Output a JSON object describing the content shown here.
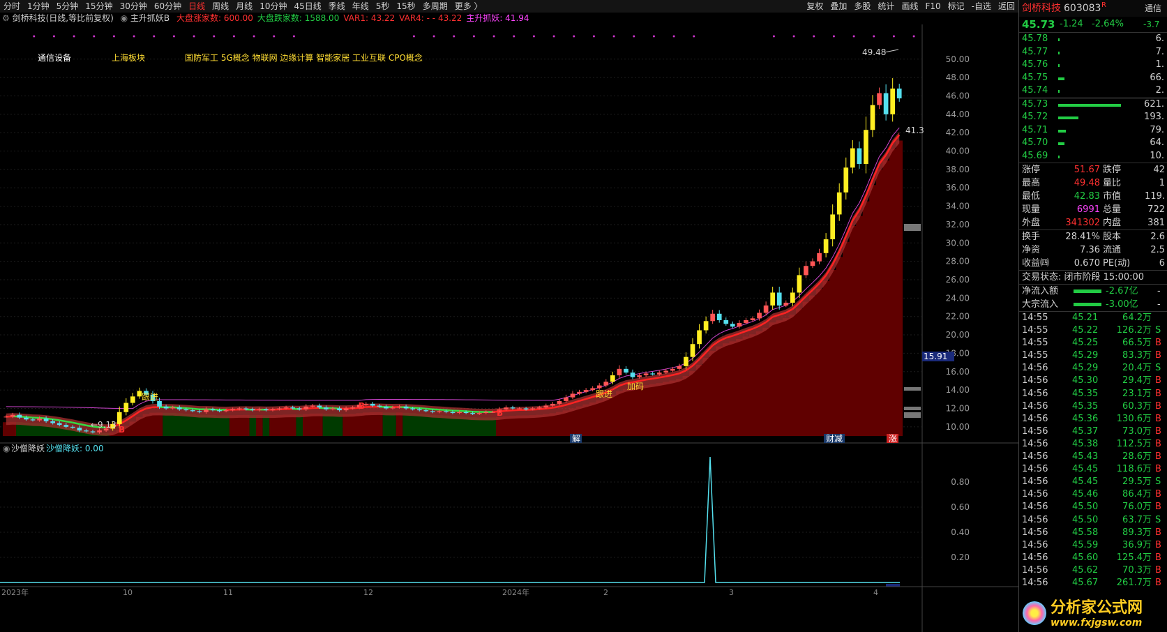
{
  "topbar": {
    "tabs": [
      "分时",
      "1分钟",
      "5分钟",
      "15分钟",
      "30分钟",
      "60分钟",
      "日线",
      "周线",
      "月线",
      "10分钟",
      "45日线",
      "季线",
      "年线",
      "5秒",
      "15秒",
      "多周期",
      "更多 〉"
    ],
    "active": "日线",
    "tools": [
      "复权",
      "叠加",
      "多股",
      "统计",
      "画线",
      "F10",
      "标记",
      "-自选",
      "返回"
    ]
  },
  "title_line": {
    "stock_title": "剑桥科技(日线,等比前复权)",
    "indicator_name": "主升抓妖B",
    "items": [
      {
        "label": "大盘涨家数: ",
        "value": "600.00",
        "color": "#ff3030"
      },
      {
        "label": "大盘跌家数: ",
        "value": "1588.00",
        "color": "#22cc44"
      },
      {
        "label": "VAR1: ",
        "value": "43.22",
        "color": "#ff3030"
      },
      {
        "label": "VAR4: ",
        "value": "- - 43.22",
        "color": "#ff3030"
      },
      {
        "label": "主升抓妖: ",
        "value": "41.94",
        "color": "#ff44ff"
      }
    ]
  },
  "concepts": {
    "industry": "通信设备",
    "region": "上海板块",
    "tags": "国防军工  5G概念  物联网  边缘计算  智能家居  工业互联  CPO概念"
  },
  "chart_data": [
    {
      "type": "candlestick",
      "title": "剑桥科技(日线,等比前复权)",
      "y_ticks": [
        "50.00",
        "48.00",
        "46.00",
        "44.00",
        "42.00",
        "40.00",
        "38.00",
        "36.00",
        "34.00",
        "32.00",
        "30.00",
        "28.00",
        "26.00",
        "24.00",
        "22.00",
        "20.00",
        "18.00",
        "16.00",
        "14.00",
        "12.00",
        "10.00"
      ],
      "ylim": [
        9.0,
        51.5
      ],
      "annotations": {
        "high_label": "49.48",
        "low_label": "9.13",
        "right_value": "41.3",
        "price_box": "15.91",
        "signals": [
          "B",
          "跟进",
          "B",
          "B",
          "跟进",
          "加码",
          "解",
          "财减",
          "涨"
        ]
      },
      "close": [
        11.1,
        11.3,
        11.0,
        10.8,
        10.7,
        10.9,
        10.6,
        10.4,
        10.2,
        10.0,
        9.9,
        9.6,
        9.5,
        9.4,
        9.6,
        9.8,
        10.3,
        11.6,
        12.6,
        13.3,
        13.9,
        13.5,
        12.8,
        12.2,
        12.0,
        12.1,
        11.9,
        11.8,
        11.7,
        11.6,
        11.9,
        11.8,
        11.7,
        11.8,
        11.9,
        12.0,
        11.9,
        11.8,
        11.9,
        11.8,
        11.9,
        12.0,
        12.1,
        12.0,
        11.9,
        12.2,
        12.3,
        12.1,
        11.9,
        12.0,
        11.8,
        12.0,
        12.1,
        12.4,
        12.5,
        12.3,
        12.2,
        12.0,
        12.1,
        12.2,
        12.0,
        11.9,
        11.8,
        11.7,
        11.6,
        11.7,
        11.6,
        11.5,
        11.6,
        11.5,
        11.4,
        11.5,
        11.6,
        11.6,
        11.9,
        12.1,
        12.0,
        12.0,
        11.9,
        12.0,
        12.1,
        12.3,
        12.5,
        12.8,
        13.2,
        13.6,
        13.8,
        14.0,
        14.2,
        14.5,
        14.9,
        15.6,
        16.3,
        15.9,
        15.4,
        15.6,
        15.8,
        15.7,
        15.9,
        16.1,
        16.3,
        16.6,
        17.6,
        19.0,
        20.5,
        21.5,
        22.3,
        21.6,
        21.2,
        20.9,
        21.3,
        21.6,
        21.8,
        22.4,
        23.2,
        24.6,
        23.2,
        23.5,
        24.6,
        26.5,
        27.5,
        28.0,
        28.9,
        30.4,
        33.1,
        35.5,
        38.2,
        40.3,
        38.6,
        42.3,
        45.0,
        46.3,
        44.0,
        46.8,
        45.73
      ]
    },
    {
      "type": "line",
      "title": "沙僧降妖",
      "series_name": "沙僧降妖",
      "value_label": "0.00",
      "y_ticks": [
        "0.80",
        "0.60",
        "0.40",
        "0.20"
      ],
      "ylim": [
        0,
        1
      ],
      "values_note": "zero everywhere except a single spike to 1 near the right side"
    }
  ],
  "x_axis_labels": [
    "2023年",
    "10",
    "11",
    "12",
    "2024年",
    "2",
    "3",
    "4"
  ],
  "right_panel": {
    "name": "剑桥科技",
    "code": "603083",
    "code_flag": "R",
    "price": "45.73",
    "change": "-1.24",
    "pct": "-2.64%",
    "sector_tag": "通信",
    "sector_pct": "-3.7",
    "asks": [
      {
        "p": "45.78",
        "v": "6.",
        "w": 2
      },
      {
        "p": "45.77",
        "v": "7.",
        "w": 2
      },
      {
        "p": "45.76",
        "v": "1.",
        "w": 2
      },
      {
        "p": "45.75",
        "v": "66.",
        "w": 10
      },
      {
        "p": "45.74",
        "v": "2.",
        "w": 2
      }
    ],
    "bids": [
      {
        "p": "45.73",
        "v": "621.",
        "w": 100
      },
      {
        "p": "45.72",
        "v": "193.",
        "w": 32
      },
      {
        "p": "45.71",
        "v": "79.",
        "w": 12
      },
      {
        "p": "45.70",
        "v": "64.",
        "w": 10
      },
      {
        "p": "45.69",
        "v": "10.",
        "w": 2
      }
    ],
    "stats": [
      {
        "k1": "涨停",
        "v1": "51.67",
        "c1": "#ff3030",
        "k2": "跌停",
        "v2": "42"
      },
      {
        "k1": "最高",
        "v1": "49.48",
        "c1": "#ff3030",
        "k2": "量比",
        "v2": "1"
      },
      {
        "k1": "最低",
        "v1": "42.83",
        "c1": "#22cc44",
        "k2": "市值",
        "v2": "119."
      },
      {
        "k1": "现量",
        "v1": "6991",
        "c1": "#ff44ff",
        "k2": "总量",
        "v2": "722"
      },
      {
        "k1": "外盘",
        "v1": "341302",
        "c1": "#ff3030",
        "k2": "内盘",
        "v2": "381"
      }
    ],
    "stats2": [
      {
        "k1": "换手",
        "v1": "28.41%",
        "c1": "#d0d0d0",
        "k2": "股本",
        "v2": "2.6"
      },
      {
        "k1": "净资",
        "v1": "7.36",
        "c1": "#d0d0d0",
        "k2": "流通",
        "v2": "2.5"
      },
      {
        "k1": "收益㈣",
        "v1": "0.670",
        "c1": "#d0d0d0",
        "k2": "PE(动)",
        "v2": "6"
      }
    ],
    "trade_status": "交易状态: 闭市阶段 15:00:00",
    "flows": [
      {
        "k": "净流入额",
        "v": "-2.67亿",
        "rest": "-"
      },
      {
        "k": "大宗流入",
        "v": "-3.00亿",
        "rest": "-"
      }
    ],
    "ticks": [
      {
        "t": "14:55",
        "p": "45.21",
        "v": "64.2万",
        "bs": ""
      },
      {
        "t": "14:55",
        "p": "45.22",
        "v": "126.2万",
        "bs": "S"
      },
      {
        "t": "14:55",
        "p": "45.25",
        "v": "66.5万",
        "bs": "B"
      },
      {
        "t": "14:55",
        "p": "45.29",
        "v": "83.3万",
        "bs": "B"
      },
      {
        "t": "14:56",
        "p": "45.29",
        "v": "20.4万",
        "bs": "S"
      },
      {
        "t": "14:56",
        "p": "45.30",
        "v": "29.4万",
        "bs": "B"
      },
      {
        "t": "14:56",
        "p": "45.35",
        "v": "23.1万",
        "bs": "B"
      },
      {
        "t": "14:56",
        "p": "45.35",
        "v": "60.3万",
        "bs": "B"
      },
      {
        "t": "14:56",
        "p": "45.36",
        "v": "130.6万",
        "bs": "B"
      },
      {
        "t": "14:56",
        "p": "45.37",
        "v": "73.0万",
        "bs": "B"
      },
      {
        "t": "14:56",
        "p": "45.38",
        "v": "112.5万",
        "bs": "B"
      },
      {
        "t": "14:56",
        "p": "45.43",
        "v": "28.6万",
        "bs": "B"
      },
      {
        "t": "14:56",
        "p": "45.45",
        "v": "118.6万",
        "bs": "B"
      },
      {
        "t": "14:56",
        "p": "45.45",
        "v": "29.5万",
        "bs": "S"
      },
      {
        "t": "14:56",
        "p": "45.46",
        "v": "86.4万",
        "bs": "B"
      },
      {
        "t": "14:56",
        "p": "45.50",
        "v": "76.0万",
        "bs": "B"
      },
      {
        "t": "14:56",
        "p": "45.50",
        "v": "63.7万",
        "bs": "S"
      },
      {
        "t": "14:56",
        "p": "45.58",
        "v": "89.3万",
        "bs": "B"
      },
      {
        "t": "14:56",
        "p": "45.59",
        "v": "36.9万",
        "bs": "B"
      },
      {
        "t": "14:56",
        "p": "45.60",
        "v": "125.4万",
        "bs": "B"
      },
      {
        "t": "14:56",
        "p": "45.62",
        "v": "70.3万",
        "bs": "B"
      },
      {
        "t": "14:56",
        "p": "45.67",
        "v": "261.7万",
        "bs": "B"
      }
    ],
    "bottom_label": "日线"
  },
  "watermark": {
    "text": "分析家公式网",
    "url": "www.fxjgsw.com"
  },
  "colors": {
    "up": "#ff3030",
    "down": "#22cc44",
    "yellow": "#ffee22",
    "cyan": "#55e0ee",
    "zone_red": "#600000",
    "zone_green": "#003a00",
    "purple": "#cc44cc"
  }
}
